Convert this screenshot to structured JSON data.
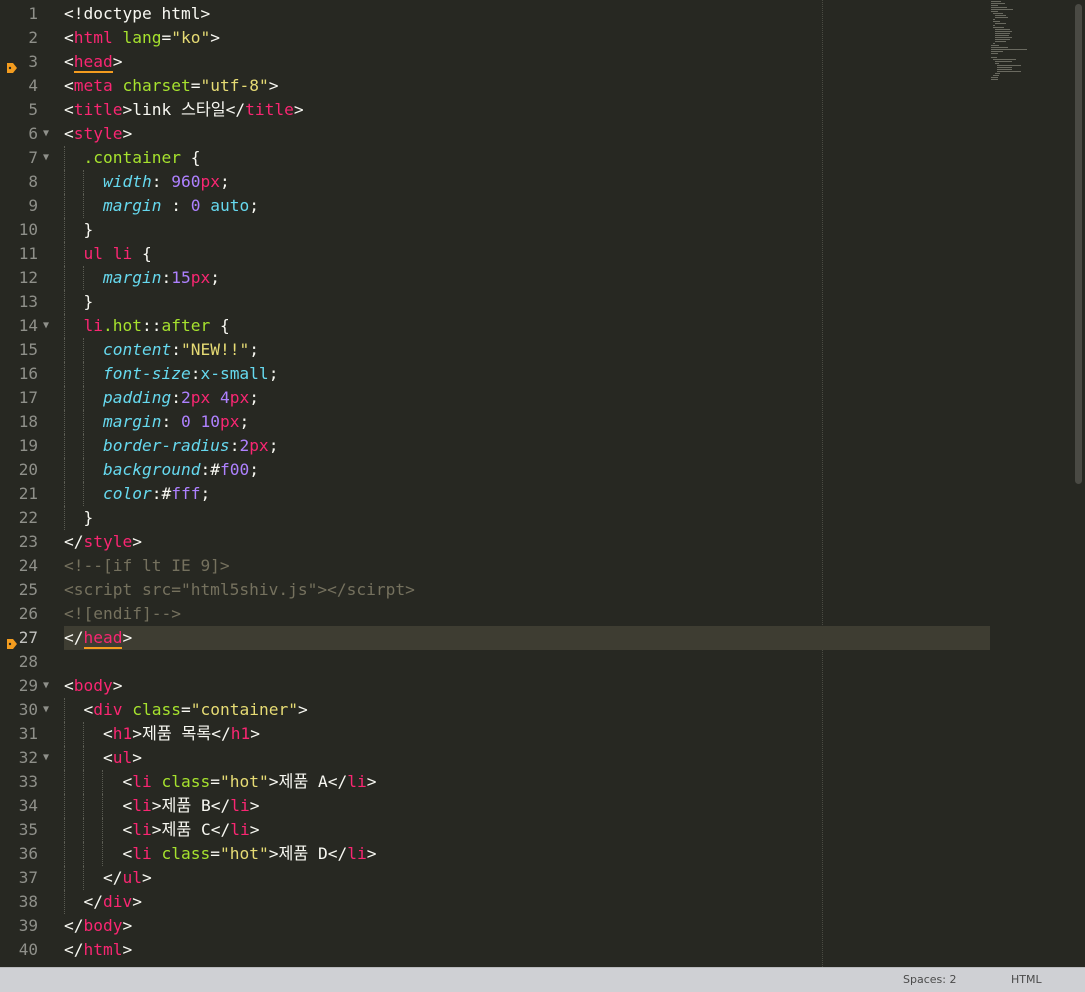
{
  "editor": {
    "current_line": 27,
    "lines": [
      {
        "n": 1,
        "segs": [
          [
            "<!doctype html>",
            ""
          ]
        ]
      },
      {
        "n": 2,
        "segs": [
          [
            "<",
            ""
          ],
          [
            "html",
            "t"
          ],
          [
            " ",
            ""
          ],
          [
            "lang",
            "a"
          ],
          [
            "=",
            ""
          ],
          [
            "\"ko\"",
            "s"
          ],
          [
            ">",
            ""
          ]
        ]
      },
      {
        "n": 3,
        "bookmark": true,
        "segs": [
          [
            "<",
            ""
          ],
          [
            "head",
            "t match"
          ],
          [
            ">",
            ""
          ]
        ]
      },
      {
        "n": 4,
        "segs": [
          [
            "<",
            ""
          ],
          [
            "meta",
            "t"
          ],
          [
            " ",
            ""
          ],
          [
            "charset",
            "a"
          ],
          [
            "=",
            ""
          ],
          [
            "\"utf-8\"",
            "s"
          ],
          [
            ">",
            ""
          ]
        ]
      },
      {
        "n": 5,
        "segs": [
          [
            "<",
            ""
          ],
          [
            "title",
            "t"
          ],
          [
            ">link 스타일</",
            ""
          ],
          [
            "title",
            "t"
          ],
          [
            ">",
            ""
          ]
        ]
      },
      {
        "n": 6,
        "fold": true,
        "segs": [
          [
            "<",
            ""
          ],
          [
            "style",
            "t"
          ],
          [
            ">",
            ""
          ]
        ]
      },
      {
        "n": 7,
        "fold": true,
        "indent": 1,
        "segs": [
          [
            "  ",
            ""
          ],
          [
            ".container",
            "a"
          ],
          [
            " {",
            ""
          ]
        ]
      },
      {
        "n": 8,
        "indent": 2,
        "segs": [
          [
            "    ",
            ""
          ],
          [
            "width",
            "p"
          ],
          [
            ": ",
            ""
          ],
          [
            "960",
            "n"
          ],
          [
            "px",
            "u"
          ],
          [
            ";",
            ""
          ]
        ]
      },
      {
        "n": 9,
        "indent": 2,
        "segs": [
          [
            "    ",
            ""
          ],
          [
            "margin",
            "p"
          ],
          [
            " : ",
            ""
          ],
          [
            "0",
            "n"
          ],
          [
            " ",
            ""
          ],
          [
            "auto",
            "k"
          ],
          [
            ";",
            ""
          ]
        ]
      },
      {
        "n": 10,
        "indent": 1,
        "segs": [
          [
            "  }",
            ""
          ]
        ]
      },
      {
        "n": 11,
        "indent": 1,
        "segs": [
          [
            "  ",
            ""
          ],
          [
            "ul li",
            "t"
          ],
          [
            " {",
            ""
          ]
        ]
      },
      {
        "n": 12,
        "indent": 2,
        "segs": [
          [
            "    ",
            ""
          ],
          [
            "margin",
            "p"
          ],
          [
            ":",
            ""
          ],
          [
            "15",
            "n"
          ],
          [
            "px",
            "u"
          ],
          [
            ";",
            ""
          ]
        ]
      },
      {
        "n": 13,
        "indent": 1,
        "segs": [
          [
            "  }",
            ""
          ]
        ]
      },
      {
        "n": 14,
        "fold": true,
        "indent": 1,
        "segs": [
          [
            "  ",
            ""
          ],
          [
            "li",
            "t"
          ],
          [
            ".hot",
            "a"
          ],
          [
            "::",
            ""
          ],
          [
            "after",
            "a"
          ],
          [
            " {",
            ""
          ]
        ]
      },
      {
        "n": 15,
        "indent": 2,
        "segs": [
          [
            "    ",
            ""
          ],
          [
            "content",
            "p"
          ],
          [
            ":",
            ""
          ],
          [
            "\"NEW!!\"",
            "s"
          ],
          [
            ";",
            ""
          ]
        ]
      },
      {
        "n": 16,
        "indent": 2,
        "segs": [
          [
            "    ",
            ""
          ],
          [
            "font-size",
            "p"
          ],
          [
            ":",
            ""
          ],
          [
            "x-small",
            "k"
          ],
          [
            ";",
            ""
          ]
        ]
      },
      {
        "n": 17,
        "indent": 2,
        "segs": [
          [
            "    ",
            ""
          ],
          [
            "padding",
            "p"
          ],
          [
            ":",
            ""
          ],
          [
            "2",
            "n"
          ],
          [
            "px",
            "u"
          ],
          [
            " ",
            ""
          ],
          [
            "4",
            "n"
          ],
          [
            "px",
            "u"
          ],
          [
            ";",
            ""
          ]
        ]
      },
      {
        "n": 18,
        "indent": 2,
        "segs": [
          [
            "    ",
            ""
          ],
          [
            "margin",
            "p"
          ],
          [
            ": ",
            ""
          ],
          [
            "0",
            "n"
          ],
          [
            " ",
            ""
          ],
          [
            "10",
            "n"
          ],
          [
            "px",
            "u"
          ],
          [
            ";",
            ""
          ]
        ]
      },
      {
        "n": 19,
        "indent": 2,
        "segs": [
          [
            "    ",
            ""
          ],
          [
            "border-radius",
            "p"
          ],
          [
            ":",
            ""
          ],
          [
            "2",
            "n"
          ],
          [
            "px",
            "u"
          ],
          [
            ";",
            ""
          ]
        ]
      },
      {
        "n": 20,
        "indent": 2,
        "segs": [
          [
            "    ",
            ""
          ],
          [
            "background",
            "p"
          ],
          [
            ":#",
            ""
          ],
          [
            "f00",
            "n"
          ],
          [
            ";",
            ""
          ]
        ]
      },
      {
        "n": 21,
        "indent": 2,
        "segs": [
          [
            "    ",
            ""
          ],
          [
            "color",
            "p"
          ],
          [
            ":#",
            ""
          ],
          [
            "fff",
            "n"
          ],
          [
            ";",
            ""
          ]
        ]
      },
      {
        "n": 22,
        "indent": 1,
        "segs": [
          [
            "  }",
            ""
          ]
        ]
      },
      {
        "n": 23,
        "segs": [
          [
            "</",
            ""
          ],
          [
            "style",
            "t"
          ],
          [
            ">",
            ""
          ]
        ]
      },
      {
        "n": 24,
        "segs": [
          [
            "<!--[if lt IE 9]>",
            "c"
          ]
        ]
      },
      {
        "n": 25,
        "segs": [
          [
            "<script src=\"html5shiv.js\"></scirpt>",
            "c"
          ]
        ]
      },
      {
        "n": 26,
        "segs": [
          [
            "<![endif]-->",
            "c"
          ]
        ]
      },
      {
        "n": 27,
        "bookmark": true,
        "segs": [
          [
            "</",
            ""
          ],
          [
            "head",
            "t match"
          ],
          [
            ">",
            ""
          ]
        ]
      },
      {
        "n": 28,
        "segs": []
      },
      {
        "n": 29,
        "fold": true,
        "segs": [
          [
            "<",
            ""
          ],
          [
            "body",
            "t"
          ],
          [
            ">",
            ""
          ]
        ]
      },
      {
        "n": 30,
        "fold": true,
        "indent": 1,
        "segs": [
          [
            "  <",
            ""
          ],
          [
            "div",
            "t"
          ],
          [
            " ",
            ""
          ],
          [
            "class",
            "a"
          ],
          [
            "=",
            ""
          ],
          [
            "\"container\"",
            "s"
          ],
          [
            ">",
            ""
          ]
        ]
      },
      {
        "n": 31,
        "indent": 2,
        "segs": [
          [
            "    <",
            ""
          ],
          [
            "h1",
            "t"
          ],
          [
            ">제품 목록</",
            ""
          ],
          [
            "h1",
            "t"
          ],
          [
            ">",
            ""
          ]
        ]
      },
      {
        "n": 32,
        "fold": true,
        "indent": 2,
        "segs": [
          [
            "    <",
            ""
          ],
          [
            "ul",
            "t"
          ],
          [
            ">",
            ""
          ]
        ]
      },
      {
        "n": 33,
        "indent": 3,
        "segs": [
          [
            "      <",
            ""
          ],
          [
            "li",
            "t"
          ],
          [
            " ",
            ""
          ],
          [
            "class",
            "a"
          ],
          [
            "=",
            ""
          ],
          [
            "\"hot\"",
            "s"
          ],
          [
            ">제품 A</",
            ""
          ],
          [
            "li",
            "t"
          ],
          [
            ">",
            ""
          ]
        ]
      },
      {
        "n": 34,
        "indent": 3,
        "segs": [
          [
            "      <",
            ""
          ],
          [
            "li",
            "t"
          ],
          [
            ">제품 B</",
            ""
          ],
          [
            "li",
            "t"
          ],
          [
            ">",
            ""
          ]
        ]
      },
      {
        "n": 35,
        "indent": 3,
        "segs": [
          [
            "      <",
            ""
          ],
          [
            "li",
            "t"
          ],
          [
            ">제품 C</",
            ""
          ],
          [
            "li",
            "t"
          ],
          [
            ">",
            ""
          ]
        ]
      },
      {
        "n": 36,
        "indent": 3,
        "segs": [
          [
            "      <",
            ""
          ],
          [
            "li",
            "t"
          ],
          [
            " ",
            ""
          ],
          [
            "class",
            "a"
          ],
          [
            "=",
            ""
          ],
          [
            "\"hot\"",
            "s"
          ],
          [
            ">제품 D</",
            ""
          ],
          [
            "li",
            "t"
          ],
          [
            ">",
            ""
          ]
        ]
      },
      {
        "n": 37,
        "indent": 2,
        "segs": [
          [
            "    </",
            ""
          ],
          [
            "ul",
            "t"
          ],
          [
            ">",
            ""
          ]
        ]
      },
      {
        "n": 38,
        "indent": 1,
        "segs": [
          [
            "  </",
            ""
          ],
          [
            "div",
            "t"
          ],
          [
            ">",
            ""
          ]
        ]
      },
      {
        "n": 39,
        "segs": [
          [
            "</",
            ""
          ],
          [
            "body",
            "t"
          ],
          [
            ">",
            ""
          ]
        ]
      },
      {
        "n": 40,
        "segs": [
          [
            "</",
            ""
          ],
          [
            "html",
            "t"
          ],
          [
            ">",
            ""
          ]
        ]
      }
    ]
  },
  "status": {
    "spaces": "Spaces: 2",
    "syntax": "HTML"
  },
  "colors": {
    "background": "#272822",
    "tag": "#f92672",
    "attribute": "#a6e22e",
    "string": "#e6db74",
    "number": "#ae81ff",
    "property": "#66d9ef",
    "comment": "#75715e",
    "bookmark": "#f39c1f"
  }
}
